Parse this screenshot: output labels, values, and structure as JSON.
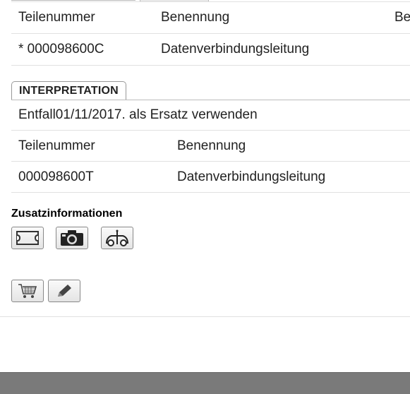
{
  "table1": {
    "headers": [
      "Teilenummer",
      "Benennung",
      "Be"
    ],
    "rows": [
      {
        "teilenummer": "* 000098600C",
        "benennung": "Datenverbindungsleitung"
      }
    ]
  },
  "interpretation": {
    "tab_label": "INTERPRETATION",
    "note": "Entfall01/11/2017. als Ersatz verwenden",
    "headers": [
      "Teilenummer",
      "Benennung"
    ],
    "rows": [
      {
        "teilenummer": "000098600T",
        "benennung": "Datenverbindungsleitung"
      }
    ]
  },
  "zusatz": {
    "title": "Zusatzinformationen",
    "icons": [
      "frame-icon",
      "camera-icon",
      "vehicle-position-icon"
    ]
  },
  "actions": {
    "icons": [
      "cart-icon",
      "pencil-icon"
    ]
  }
}
